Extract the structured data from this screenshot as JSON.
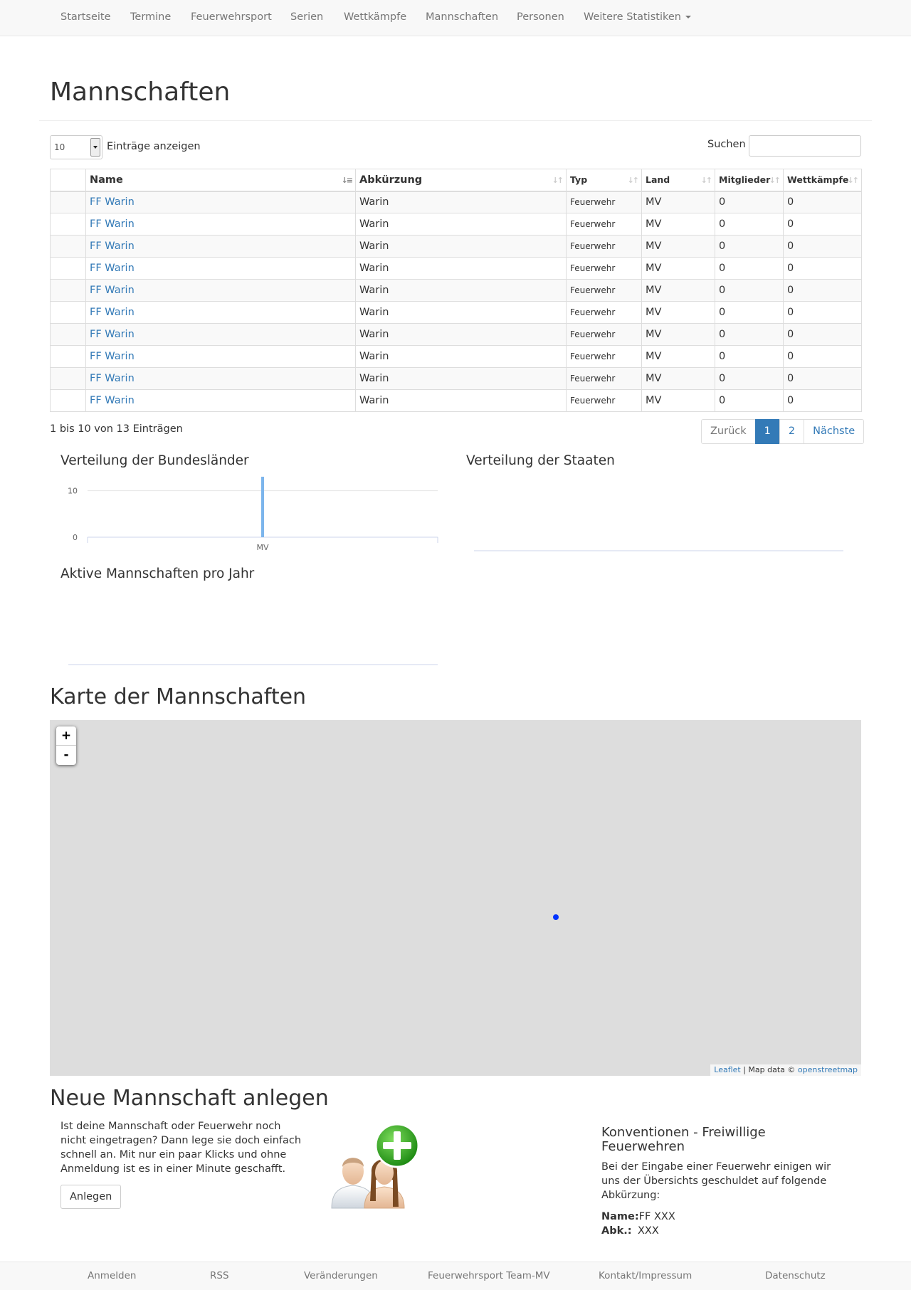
{
  "nav": {
    "items": [
      "Startseite",
      "Termine",
      "Feuerwehrsport",
      "Serien",
      "Wettkämpfe",
      "Mannschaften",
      "Personen"
    ],
    "dropdown_label": "Weitere Statistiken"
  },
  "page_title": "Mannschaften",
  "table_controls": {
    "length_value": "10",
    "length_label": "Einträge anzeigen",
    "search_label": "Suchen",
    "search_value": ""
  },
  "table": {
    "columns": [
      "",
      "Name",
      "Abkürzung",
      "Typ",
      "Land",
      "Mitglieder",
      "Wettkämpfe"
    ],
    "rows": [
      [
        "",
        "FF Warin",
        "Warin",
        "Feuerwehr",
        "MV",
        "0",
        "0"
      ],
      [
        "",
        "FF Warin",
        "Warin",
        "Feuerwehr",
        "MV",
        "0",
        "0"
      ],
      [
        "",
        "FF Warin",
        "Warin",
        "Feuerwehr",
        "MV",
        "0",
        "0"
      ],
      [
        "",
        "FF Warin",
        "Warin",
        "Feuerwehr",
        "MV",
        "0",
        "0"
      ],
      [
        "",
        "FF Warin",
        "Warin",
        "Feuerwehr",
        "MV",
        "0",
        "0"
      ],
      [
        "",
        "FF Warin",
        "Warin",
        "Feuerwehr",
        "MV",
        "0",
        "0"
      ],
      [
        "",
        "FF Warin",
        "Warin",
        "Feuerwehr",
        "MV",
        "0",
        "0"
      ],
      [
        "",
        "FF Warin",
        "Warin",
        "Feuerwehr",
        "MV",
        "0",
        "0"
      ],
      [
        "",
        "FF Warin",
        "Warin",
        "Feuerwehr",
        "MV",
        "0",
        "0"
      ],
      [
        "",
        "FF Warin",
        "Warin",
        "Feuerwehr",
        "MV",
        "0",
        "0"
      ]
    ],
    "info": "1 bis 10 von 13 Einträgen",
    "pagination": {
      "prev": "Zurück",
      "pages": [
        "1",
        "2"
      ],
      "next": "Nächste",
      "active_page": "1"
    }
  },
  "chart_data": [
    {
      "type": "bar",
      "title": "Verteilung der Bundesländer",
      "categories": [
        "MV"
      ],
      "values": [
        13
      ],
      "yticks": [
        "0",
        "10"
      ],
      "ylim": [
        0,
        13
      ],
      "xlabel": "",
      "ylabel": "",
      "color": "#7cb5ec",
      "grid": true
    },
    {
      "type": "bar",
      "title": "Verteilung der Staaten",
      "categories": [],
      "values": []
    },
    {
      "type": "line",
      "title": "Aktive Mannschaften pro Jahr",
      "x": [],
      "y": []
    }
  ],
  "map": {
    "title": "Karte der Mannschaften",
    "zoom_in": "+",
    "zoom_out": "-",
    "attribution_leaflet": "Leaflet",
    "attribution_sep": "| Map data ©",
    "attribution_osm": "openstreetmap",
    "marker_color": "#0033ff"
  },
  "new_team": {
    "title": "Neue Mannschaft anlegen",
    "text": "Ist deine Mannschaft oder Feuerwehr noch nicht eingetragen? Dann lege sie doch einfach schnell an. Mit nur ein paar Klicks und ohne Anmeldung ist es in einer Minute geschafft.",
    "button": "Anlegen",
    "conventions_title": "Konventionen - Freiwillige Feuerwehren",
    "conventions_text": "Bei der Eingabe einer Feuerwehr einigen wir uns der Übersichts geschuldet auf folgende Abkürzung:",
    "name_label": "Name:",
    "name_value": "FF XXX",
    "abk_label": "Abk.:",
    "abk_value": "XXX"
  },
  "footer": {
    "items": [
      "Anmelden",
      "RSS",
      "Veränderungen",
      "Feuerwehrsport Team-MV",
      "Kontakt/Impressum",
      "Datenschutz"
    ]
  },
  "colors": {
    "link": "#337ab7",
    "active_page": "#337ab7",
    "bar": "#7cb5ec"
  }
}
